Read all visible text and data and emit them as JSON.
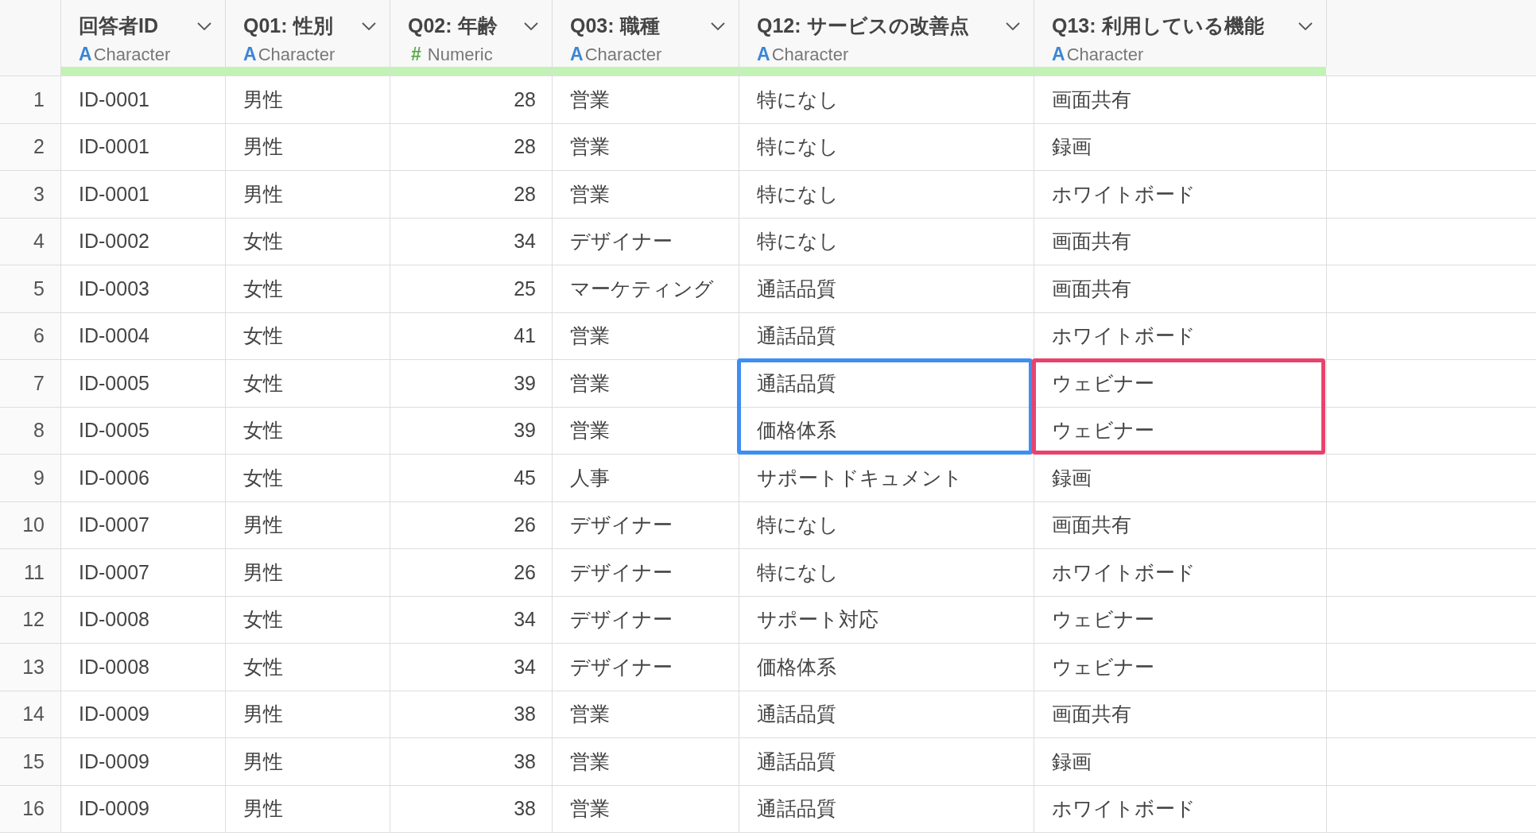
{
  "columns": [
    {
      "name": "回答者ID",
      "type_icon": "A",
      "type": "Character",
      "kind": "character"
    },
    {
      "name": "Q01: 性別",
      "type_icon": "A",
      "type": "Character",
      "kind": "character"
    },
    {
      "name": "Q02: 年齢",
      "type_icon": "#",
      "type": "Numeric",
      "kind": "numeric"
    },
    {
      "name": "Q03: 職種",
      "type_icon": "A",
      "type": "Character",
      "kind": "character"
    },
    {
      "name": "Q12: サービスの改善点",
      "type_icon": "A",
      "type": "Character",
      "kind": "character"
    },
    {
      "name": "Q13: 利用している機能",
      "type_icon": "A",
      "type": "Character",
      "kind": "character"
    }
  ],
  "rows": [
    {
      "num": "1",
      "cells": [
        {
          "text": "ID-0001"
        },
        {
          "text": "男性"
        },
        {
          "text": "28"
        },
        {
          "text": "営業"
        },
        {
          "text": "特になし"
        },
        {
          "text": "画面共有"
        }
      ]
    },
    {
      "num": "2",
      "cells": [
        {
          "text": "ID-0001"
        },
        {
          "text": "男性"
        },
        {
          "text": "28"
        },
        {
          "text": "営業"
        },
        {
          "text": "特になし"
        },
        {
          "text": "録画"
        }
      ]
    },
    {
      "num": "3",
      "cells": [
        {
          "text": "ID-0001"
        },
        {
          "text": "男性"
        },
        {
          "text": "28"
        },
        {
          "text": "営業"
        },
        {
          "text": "特になし"
        },
        {
          "text": "ホワイトボード"
        }
      ]
    },
    {
      "num": "4",
      "cells": [
        {
          "text": "ID-0002"
        },
        {
          "text": "女性"
        },
        {
          "text": "34"
        },
        {
          "text": "デザイナー"
        },
        {
          "text": "特になし"
        },
        {
          "text": "画面共有"
        }
      ]
    },
    {
      "num": "5",
      "cells": [
        {
          "text": "ID-0003"
        },
        {
          "text": "女性"
        },
        {
          "text": "25"
        },
        {
          "text": "マーケティング"
        },
        {
          "text": "通話品質"
        },
        {
          "text": "画面共有"
        }
      ]
    },
    {
      "num": "6",
      "cells": [
        {
          "text": "ID-0004"
        },
        {
          "text": "女性"
        },
        {
          "text": "41"
        },
        {
          "text": "営業"
        },
        {
          "text": "通話品質"
        },
        {
          "text": "ホワイトボード"
        }
      ]
    },
    {
      "num": "7",
      "cells": [
        {
          "text": "ID-0005"
        },
        {
          "text": "女性"
        },
        {
          "text": "39"
        },
        {
          "text": "営業"
        },
        {
          "text": "通話品質",
          "color": "#3d8ef2"
        },
        {
          "text": "ウェビナー",
          "color": "#e8436c"
        }
      ]
    },
    {
      "num": "8",
      "cells": [
        {
          "text": "ID-0005"
        },
        {
          "text": "女性"
        },
        {
          "text": "39"
        },
        {
          "text": "営業"
        },
        {
          "text": "価格体系",
          "color": "#3d8ef2"
        },
        {
          "text": "ウェビナー",
          "color": "#e8436c"
        }
      ]
    },
    {
      "num": "9",
      "cells": [
        {
          "text": "ID-0006"
        },
        {
          "text": "女性"
        },
        {
          "text": "45"
        },
        {
          "text": "人事"
        },
        {
          "text": "サポートドキュメント"
        },
        {
          "text": "録画"
        }
      ]
    },
    {
      "num": "10",
      "cells": [
        {
          "text": "ID-0007"
        },
        {
          "text": "男性"
        },
        {
          "text": "26"
        },
        {
          "text": "デザイナー"
        },
        {
          "text": "特になし"
        },
        {
          "text": "画面共有"
        }
      ]
    },
    {
      "num": "11",
      "cells": [
        {
          "text": "ID-0007"
        },
        {
          "text": "男性"
        },
        {
          "text": "26"
        },
        {
          "text": "デザイナー"
        },
        {
          "text": "特になし"
        },
        {
          "text": "ホワイトボード"
        }
      ]
    },
    {
      "num": "12",
      "cells": [
        {
          "text": "ID-0008"
        },
        {
          "text": "女性"
        },
        {
          "text": "34"
        },
        {
          "text": "デザイナー"
        },
        {
          "text": "サポート対応"
        },
        {
          "text": "ウェビナー"
        }
      ]
    },
    {
      "num": "13",
      "cells": [
        {
          "text": "ID-0008"
        },
        {
          "text": "女性"
        },
        {
          "text": "34"
        },
        {
          "text": "デザイナー"
        },
        {
          "text": "価格体系"
        },
        {
          "text": "ウェビナー"
        }
      ]
    },
    {
      "num": "14",
      "cells": [
        {
          "text": "ID-0009"
        },
        {
          "text": "男性"
        },
        {
          "text": "38"
        },
        {
          "text": "営業"
        },
        {
          "text": "通話品質"
        },
        {
          "text": "画面共有"
        }
      ]
    },
    {
      "num": "15",
      "cells": [
        {
          "text": "ID-0009"
        },
        {
          "text": "男性"
        },
        {
          "text": "38"
        },
        {
          "text": "営業"
        },
        {
          "text": "通話品質"
        },
        {
          "text": "録画"
        }
      ]
    },
    {
      "num": "16",
      "cells": [
        {
          "text": "ID-0009"
        },
        {
          "text": "男性"
        },
        {
          "text": "38"
        },
        {
          "text": "営業"
        },
        {
          "text": "通話品質"
        },
        {
          "text": "ホワイトボード"
        }
      ]
    }
  ]
}
